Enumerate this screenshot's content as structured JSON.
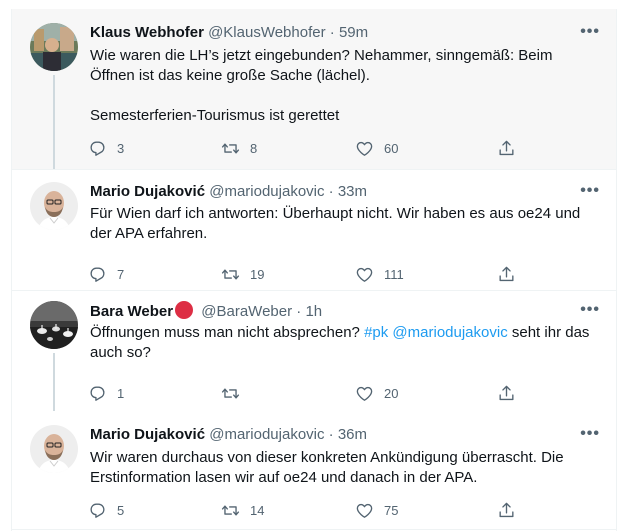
{
  "tweets": [
    {
      "name": "Klaus Webhofer",
      "handle": "@KlausWebhofer",
      "time": "59m",
      "line1": "Wie waren die LH’s jetzt eingebunden? Nehammer, sinngemäß: Beim",
      "line2": "Öffnen ist das keine große Sache (lächel).",
      "line3": "Semesterferien-Tourismus ist gerettet",
      "replies": "3",
      "retweets": "8",
      "likes": "60"
    },
    {
      "name": "Mario Dujaković",
      "handle": "@mariodujakovic",
      "time": "33m",
      "line1": "Für Wien darf ich antworten: Überhaupt nicht. Wir haben es aus oe24 und",
      "line2": "der APA erfahren.",
      "replies": "7",
      "retweets": "19",
      "likes": "111"
    },
    {
      "name": "Bara Weber",
      "handle": "@BaraWeber",
      "time": "1h",
      "text_plain": "Öffnungen muss man nicht absprechen?",
      "hashtag": "#pk",
      "mention": "@mariodujakovic",
      "text_tail": "seht ihr das",
      "line2": "auch so?",
      "replies": "1",
      "retweets": "",
      "likes": "20"
    },
    {
      "name": "Mario Dujaković",
      "handle": "@mariodujakovic",
      "time": "36m",
      "line1": "Wir waren durchaus von dieser konkreten Ankündigung überrascht. Die",
      "line2": "Erstinformation lasen wir auf oe24 und danach in der APA.",
      "replies": "5",
      "retweets": "14",
      "likes": "75"
    }
  ],
  "dot": "·",
  "more_label": "•••",
  "icons": [
    "reply-icon",
    "retweet-icon",
    "like-icon",
    "share-icon"
  ],
  "colors": {
    "link": "#1d9bf0",
    "secondary": "#536471",
    "highlight_bg": "#f7f7f7",
    "thread_line": "#cfd9de"
  }
}
